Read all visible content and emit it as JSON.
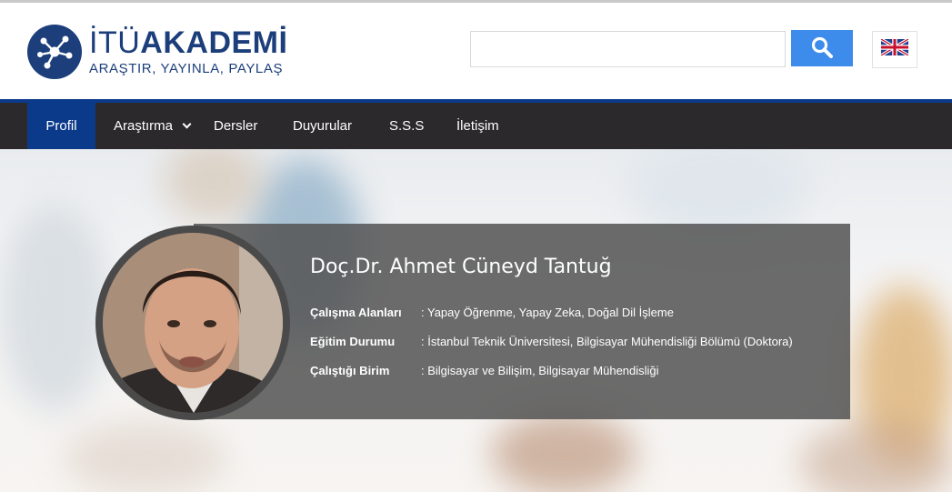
{
  "header": {
    "logo_title_prefix": "İTÜ",
    "logo_title_main": "AKADEMİ",
    "logo_slogan": "ARAŞTIR, YAYINLA, PAYLAŞ",
    "search_placeholder": "",
    "search_icon": "search-icon",
    "language_icon": "uk-flag-icon"
  },
  "nav": {
    "items": [
      {
        "label": "Profil",
        "active": true
      },
      {
        "label": "Araştırma",
        "has_dropdown": true
      },
      {
        "label": "Dersler"
      },
      {
        "label": "Duyurular"
      },
      {
        "label": "S.S.S"
      },
      {
        "label": "İletişim"
      }
    ]
  },
  "profile": {
    "name": "Doç.Dr. Ahmet Cüneyd Tantuğ",
    "fields": [
      {
        "label": "Çalışma Alanları",
        "value": ": Yapay Öğrenme, Yapay Zeka, Doğal Dil İşleme"
      },
      {
        "label": "Eğitim Durumu",
        "value": ": İstanbul Teknik Üniversitesi, Bilgisayar Mühendisliği Bölümü (Doktora)"
      },
      {
        "label": "Çalıştığı Birim",
        "value": ": Bilgisayar ve Bilişim, Bilgisayar Mühendisliği"
      }
    ]
  },
  "colors": {
    "brand": "#1c3f7c",
    "nav_active": "#0b3a8b",
    "nav_bg": "#2b292c",
    "search_button": "#3d8bea"
  }
}
